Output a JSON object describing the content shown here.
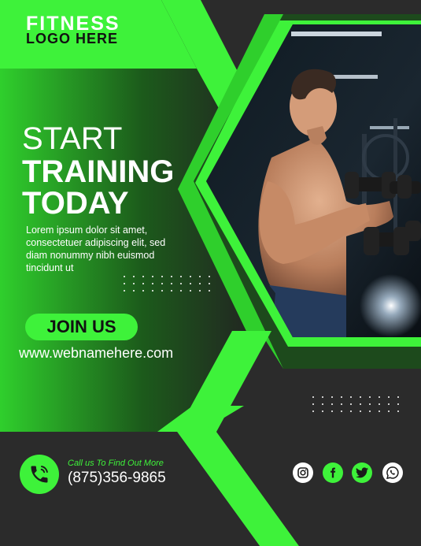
{
  "logo": {
    "line1": "FITNESS",
    "line2": "LOGO HERE"
  },
  "headline": {
    "line1": "START",
    "line2": "TRAINING",
    "line3": "TODAY"
  },
  "body_text": "Lorem ipsum dolor sit amet, consectetuer adipiscing elit, sed diam nonummy nibh euismod tincidunt ut",
  "cta": {
    "label": "JOIN US"
  },
  "website": "www.webnamehere.com",
  "contact": {
    "label": "Call us To Find Out More",
    "phone": "(875)356-9865"
  },
  "social": [
    {
      "name": "instagram-icon"
    },
    {
      "name": "facebook-icon"
    },
    {
      "name": "twitter-icon"
    },
    {
      "name": "whatsapp-icon"
    }
  ],
  "colors": {
    "accent": "#3ef23a",
    "dark": "#2b2b2b",
    "green_dark": "#1f4d1e"
  }
}
